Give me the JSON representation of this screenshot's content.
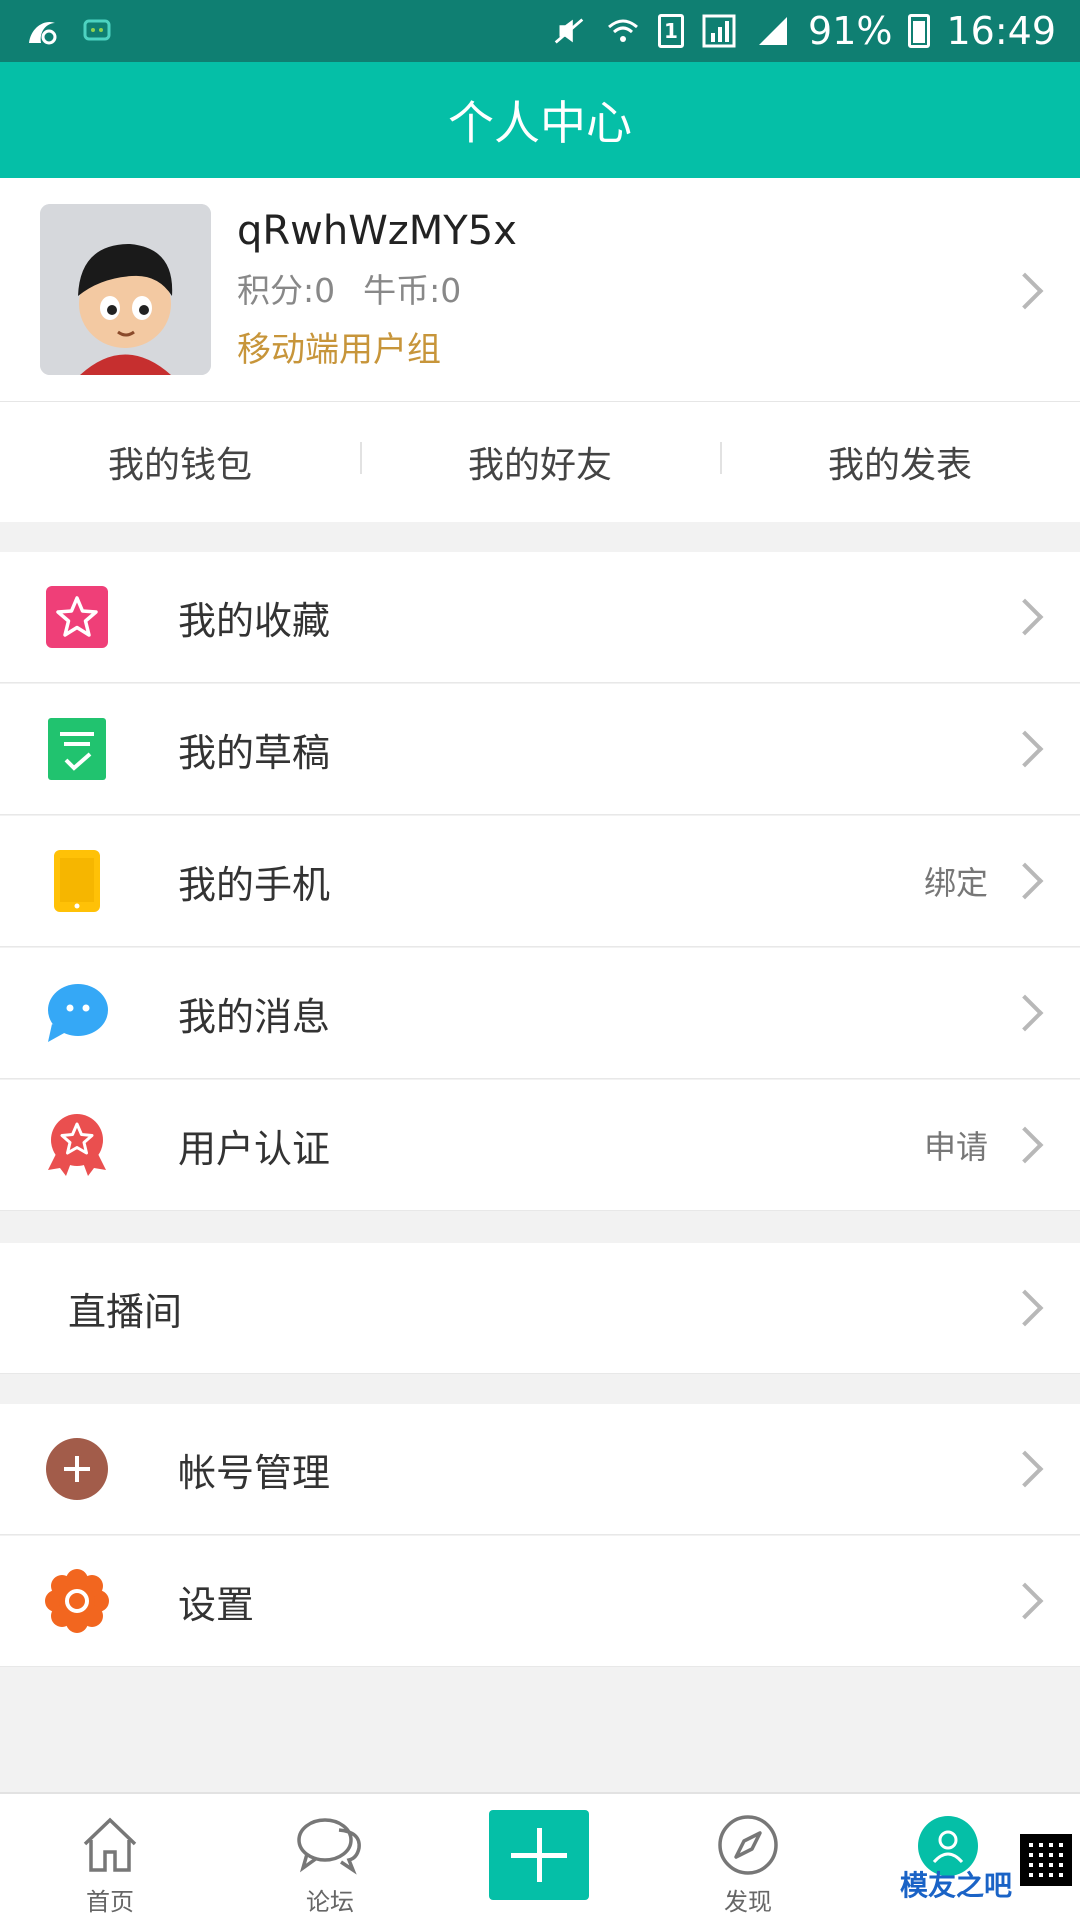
{
  "status_bar": {
    "battery": "91%",
    "time": "16:49",
    "sim": "1",
    "icons": [
      "uc-browser-icon",
      "chat-notification-icon",
      "mute-icon",
      "wifi-icon",
      "sim-icon",
      "signal-icon",
      "battery-icon"
    ]
  },
  "header": {
    "title": "个人中心"
  },
  "profile": {
    "username": "qRwhWzMY5x",
    "points": "积分:0",
    "coins": "牛币:0",
    "group": "移动端用户组"
  },
  "quick_links": [
    "我的钱包",
    "我的好友",
    "我的发表"
  ],
  "menu": {
    "section1": [
      {
        "label": "我的收藏",
        "icon": "star-icon",
        "color": "#ef3f78"
      },
      {
        "label": "我的草稿",
        "icon": "draft-icon",
        "color": "#21c36f"
      },
      {
        "label": "我的手机",
        "icon": "phone-icon",
        "color": "#ffc107",
        "extra": "绑定"
      },
      {
        "label": "我的消息",
        "icon": "message-icon",
        "color": "#35a8f6"
      },
      {
        "label": "用户认证",
        "icon": "badge-icon",
        "color": "#ea4f4f",
        "extra": "申请"
      }
    ],
    "section2": [
      {
        "label": "直播间"
      }
    ],
    "section3": [
      {
        "label": "帐号管理",
        "icon": "add-account-icon",
        "color": "#a25c4a"
      },
      {
        "label": "设置",
        "icon": "settings-icon",
        "color": "#f2661f"
      }
    ]
  },
  "bottom_nav": {
    "home": "首页",
    "forum": "论坛",
    "discover": "发现",
    "profile_accent": "#05bfa7"
  },
  "watermark": {
    "text": "模友之吧"
  }
}
